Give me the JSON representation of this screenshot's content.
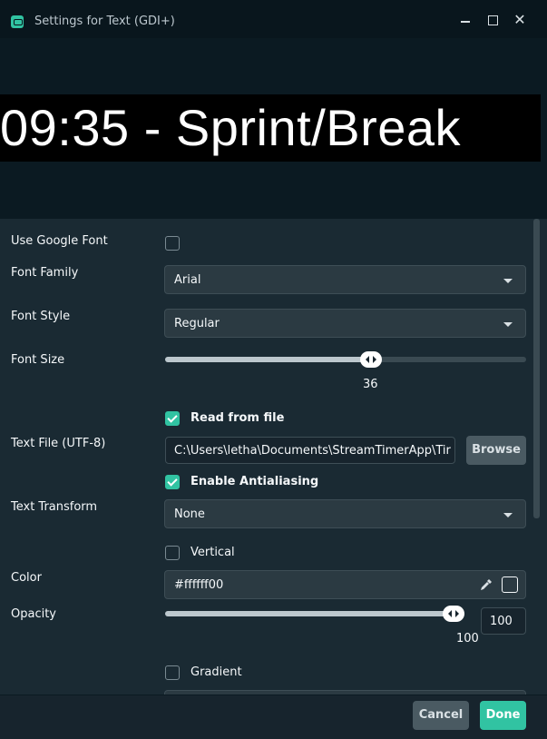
{
  "window": {
    "title": "Settings for Text (GDI+)",
    "minimize_label": "",
    "maximize_label": "",
    "close_label": "✕"
  },
  "preview": {
    "text": "09:35 - Sprint/Break"
  },
  "form": {
    "use_google_font": {
      "label": "Use Google Font",
      "checked": false
    },
    "font_family": {
      "label": "Font Family",
      "value": "Arial"
    },
    "font_style": {
      "label": "Font Style",
      "value": "Regular"
    },
    "font_size": {
      "label": "Font Size",
      "value": "36",
      "fraction": 0.57
    },
    "read_from_file": {
      "label": "Read from file",
      "checked": true
    },
    "text_file": {
      "label": "Text File (UTF-8)",
      "value": "C:\\Users\\letha\\Documents\\StreamTimerApp\\Tir",
      "browse_label": "Browse"
    },
    "antialiasing": {
      "label": "Enable Antialiasing",
      "checked": true
    },
    "text_transform": {
      "label": "Text Transform",
      "value": "None"
    },
    "vertical": {
      "label": "Vertical",
      "checked": false
    },
    "color": {
      "label": "Color",
      "value": "#ffffff00"
    },
    "opacity": {
      "label": "Opacity",
      "value": "100",
      "input_value": "100",
      "fraction": 1.0
    },
    "gradient": {
      "label": "Gradient",
      "checked": false
    }
  },
  "footer": {
    "cancel_label": "Cancel",
    "done_label": "Done"
  },
  "colors": {
    "accent": "#31c3a2",
    "background": "#17242d",
    "panel": "#1a2a33"
  }
}
